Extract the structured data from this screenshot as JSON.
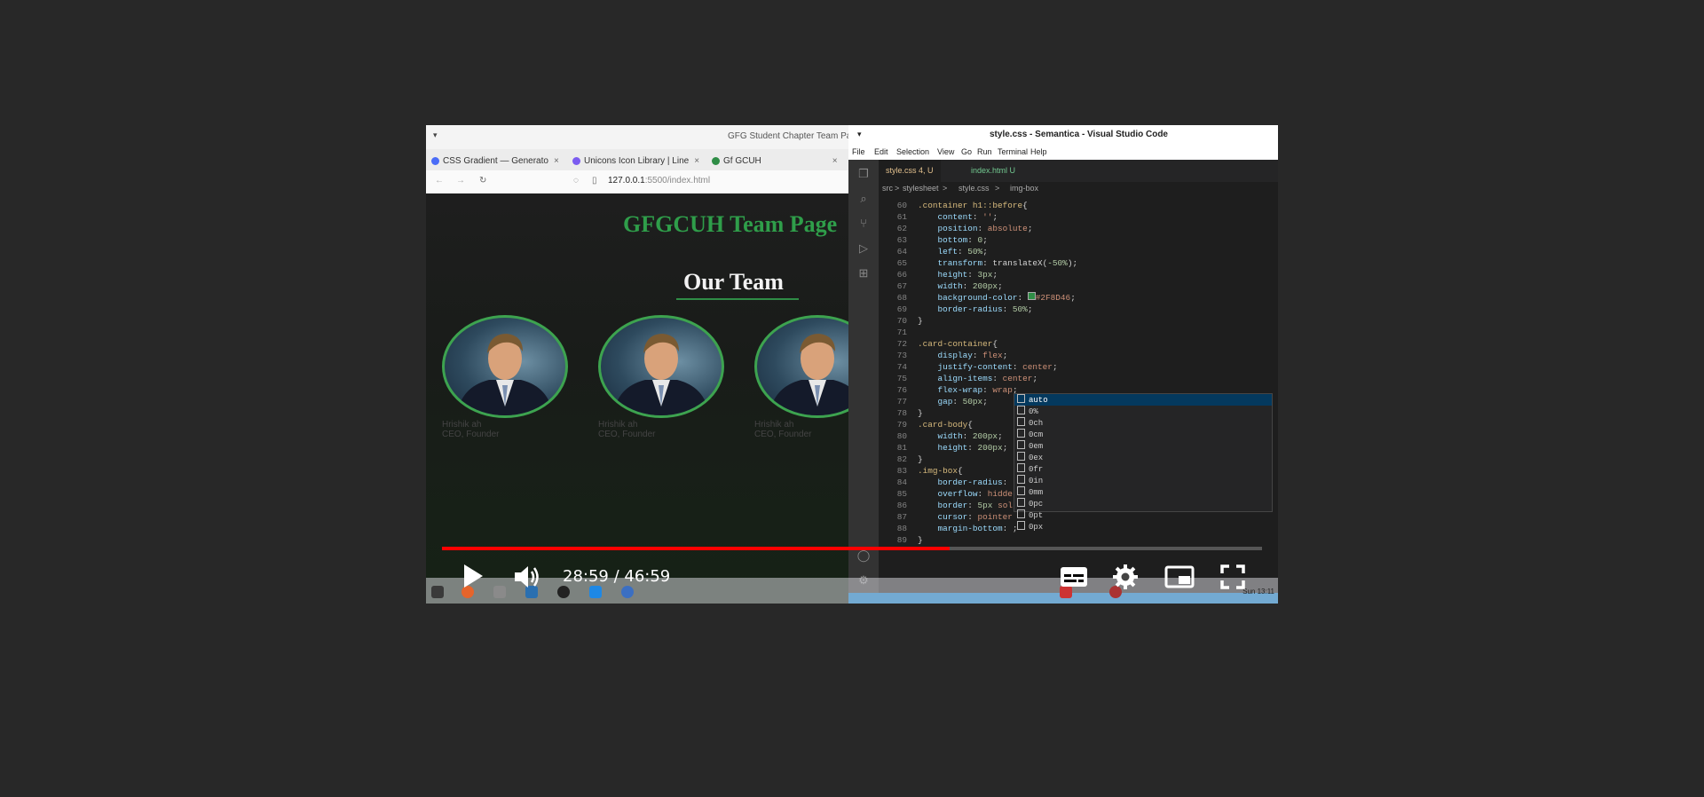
{
  "browser": {
    "window_title": "GFG Student Chapter Team Pa",
    "tabs": [
      {
        "label": "CSS Gradient — Generato",
        "color": "#4a6cf7"
      },
      {
        "label": "Unicons Icon Library | Line",
        "color": "#7b5cf0"
      },
      {
        "label": "Gf GCUH",
        "color": "#2f8d46"
      }
    ],
    "url_host": "127.0.0.1",
    "url_rest": ":5500/index.html",
    "site_title": "GFGCUH Team Page",
    "team_heading": "Our Team",
    "members": [
      {
        "name": "Hrishik ah",
        "role": "CEO, Founder"
      },
      {
        "name": "Hrishik ah",
        "role": "CEO, Founder"
      },
      {
        "name": "Hrishik ah",
        "role": "CEO, Founder"
      }
    ]
  },
  "vscode": {
    "title": "style.css - Semantica - Visual Studio Code",
    "menu": [
      "File",
      "Edit",
      "Selection",
      "View",
      "Go",
      "Run",
      "Terminal",
      "Help"
    ],
    "tabs": [
      {
        "label": "style.css 4, U",
        "color": "#e2c08d"
      },
      {
        "label": "index.html U",
        "color": "#73c991"
      }
    ],
    "breadcrumb": [
      "src",
      ">",
      "stylesheet",
      ">",
      "style.css",
      ">",
      "img-box"
    ],
    "suggestions": [
      "auto",
      "0%",
      "0ch",
      "0cm",
      "0em",
      "0ex",
      "0fr",
      "0in",
      "0mm",
      "0pc",
      "0pt",
      "0px"
    ]
  },
  "player": {
    "time_display": "28:59 / 46:59",
    "progress": 0.6188,
    "clock": "Sun 13:11",
    "accent": "#ff0000"
  }
}
